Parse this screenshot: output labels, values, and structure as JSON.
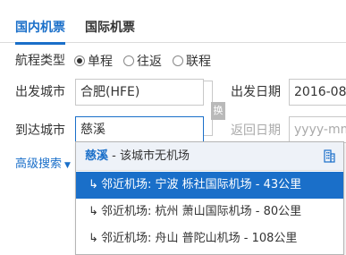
{
  "tabs": {
    "domestic": "国内机票",
    "international": "国际机票"
  },
  "trip_type": {
    "label": "航程类型",
    "options": [
      "单程",
      "往返",
      "联程"
    ],
    "selected": "单程"
  },
  "departure": {
    "label": "出发城市",
    "value": "合肥(HFE)"
  },
  "departure_date": {
    "label": "出发日期",
    "value": "2016-08-"
  },
  "arrival": {
    "label": "到达城市",
    "value": "慈溪"
  },
  "return_date": {
    "label": "返回日期",
    "placeholder": "yyyy-mm"
  },
  "swap_label": "换",
  "advanced": {
    "label": "高级搜索",
    "caret": "▼"
  },
  "dropdown": {
    "city": "慈溪",
    "note": " - 该城市无机场",
    "icon": "building-icon",
    "items": [
      {
        "arrow": "↳",
        "text": "邻近机场: 宁波 栎社国际机场 - 43公里"
      },
      {
        "arrow": "↳",
        "text": "邻近机场: 杭州 萧山国际机场 - 80公里"
      },
      {
        "arrow": "↳",
        "text": "邻近机场: 舟山 普陀山机场 - 108公里"
      }
    ],
    "selected_index": 0
  },
  "colors": {
    "accent": "#1a6fc9",
    "header_bg": "#eef2f8",
    "border": "#c8c8c8"
  }
}
